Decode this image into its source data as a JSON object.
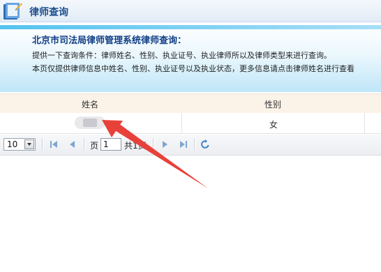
{
  "window": {
    "title": "律师查询"
  },
  "banner": {
    "heading": "北京市司法局律师管理系统律师查询：",
    "line1": "提供一下查询条件：律师姓名、性别、执业证号、执业律师所以及律师类型来进行查询。",
    "line2": "本页仅提供律师信息中姓名、性别、执业证号以及执业状态，更多信息请点击律师姓名进行查看"
  },
  "grid": {
    "columns": [
      "姓名",
      "性别"
    ],
    "rows": [
      {
        "name": "",
        "gender": "女"
      }
    ]
  },
  "pager": {
    "page_size": "10",
    "page_label": "页",
    "page_value": "1",
    "total_label": "共1页"
  },
  "colors": {
    "accent": "#1d4f8f",
    "arrow": "#e8413a"
  },
  "icons": [
    "app-icon",
    "first-page-icon",
    "prev-page-icon",
    "next-page-icon",
    "last-page-icon",
    "refresh-icon"
  ]
}
